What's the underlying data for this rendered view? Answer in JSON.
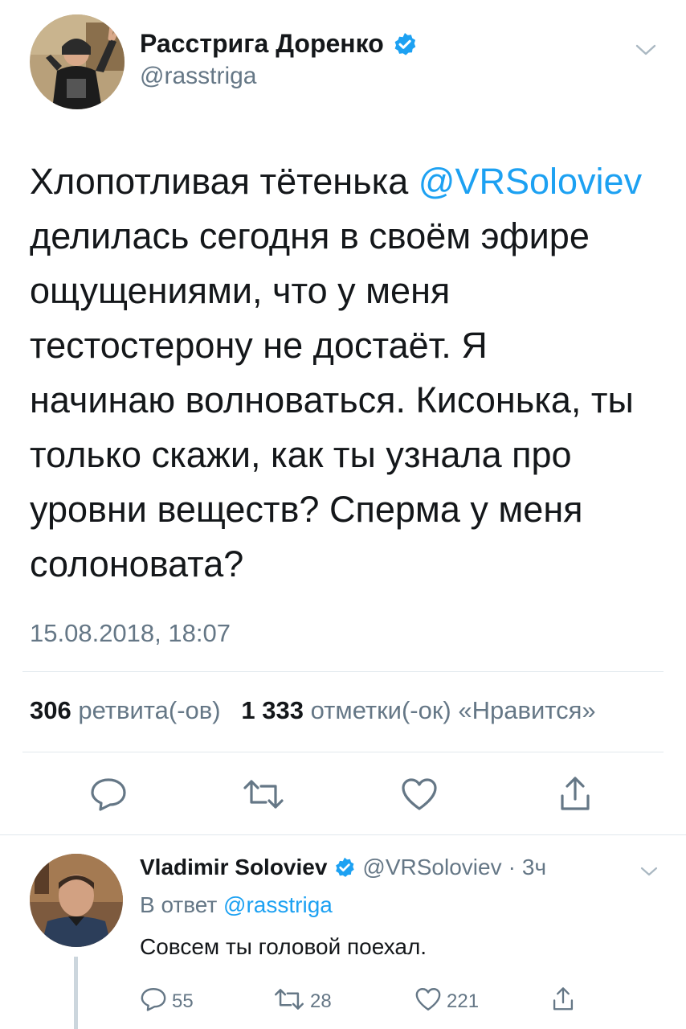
{
  "tweet": {
    "author_name": "Расстрига Доренко",
    "author_handle": "@rasstriga",
    "text_lines": [
      {
        "before": "Хлопотливая тётенька ",
        "mention": "@VRSoloviev"
      },
      {
        "before": "делилась сегодня в своём эфире"
      },
      {
        "before": "ощущениями, что у меня"
      },
      {
        "before": "тестостерону не достаёт. Я"
      },
      {
        "before": "начинаю волноваться. Кисонька, ты"
      },
      {
        "before": "только скажи, как ты узнала про"
      },
      {
        "before": "уровни веществ? Сперма у меня"
      },
      {
        "before": "солоновата?"
      }
    ],
    "timestamp": "15.08.2018, 18:07",
    "stats": {
      "retweets": "306",
      "retweets_label": "ретвита(-ов)",
      "likes": "1 333",
      "likes_label": "отметки(-ок) «Нравится»"
    }
  },
  "reply": {
    "author_name": "Vladimir Soloviev",
    "author_handle": "@VRSoloviev",
    "dot": "·",
    "time": "3ч",
    "reply_to_label": "В ответ",
    "reply_to_handle": "@rasstriga",
    "text": "Совсем ты головой поехал.",
    "counts": {
      "replies": "55",
      "retweets": "28",
      "likes": "221"
    }
  },
  "colors": {
    "accent": "#1da1f2",
    "muted": "#657786",
    "text": "#14171a",
    "divider": "#e1e8ed"
  },
  "icons": [
    "chevron-down-icon",
    "verified-badge-icon",
    "reply-icon",
    "retweet-icon",
    "like-icon",
    "share-icon"
  ]
}
